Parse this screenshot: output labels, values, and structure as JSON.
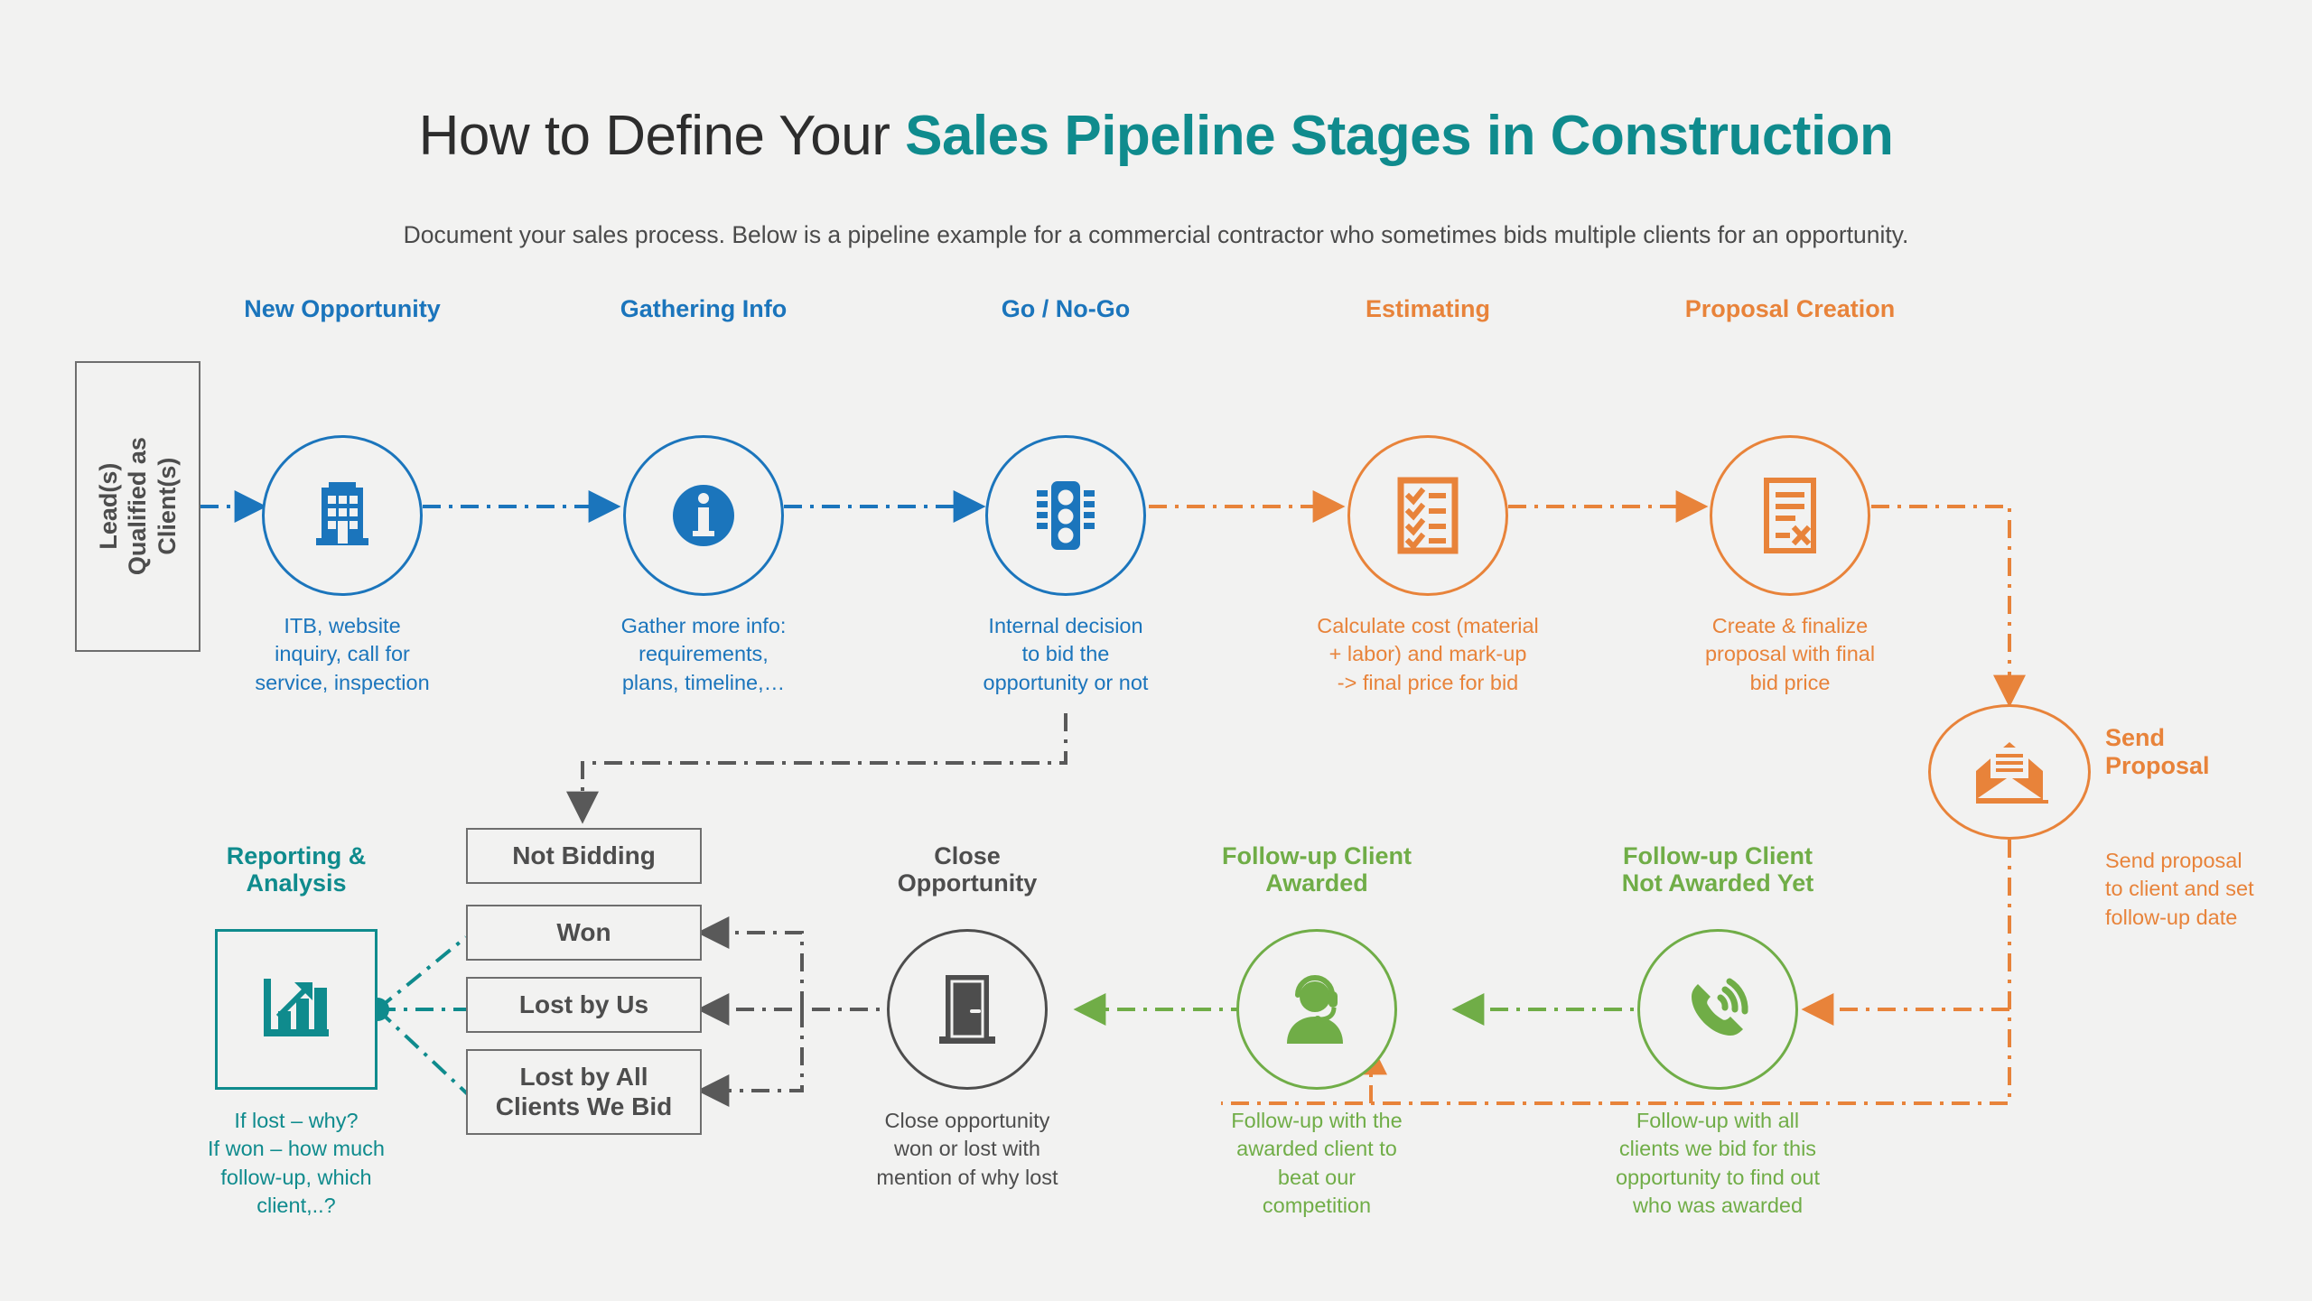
{
  "header": {
    "title_plain": "How to Define Your ",
    "title_accent": "Sales Pipeline Stages in Construction",
    "subtitle": "Document your sales process. Below is a pipeline example for a commercial contractor who sometimes bids multiple clients for an opportunity."
  },
  "colors": {
    "background": "#f2f2f1",
    "blue": "#1b75bc",
    "orange": "#e8833a",
    "green": "#70ad47",
    "teal": "#0f8b8d",
    "gray": "#4d4d4d",
    "gray_line": "#595959"
  },
  "lead_box": {
    "line1": "Lead(s)",
    "line2": "Qualified as",
    "line3": "Client(s)"
  },
  "stages": [
    {
      "id": "new-opportunity",
      "label": "New Opportunity",
      "icon": "office-building-icon",
      "color": "#1b75bc",
      "desc": [
        "ITB, website",
        "inquiry, call for",
        "service, inspection"
      ]
    },
    {
      "id": "gathering-info",
      "label": "Gathering Info",
      "icon": "info-circle-icon",
      "color": "#1b75bc",
      "desc": [
        "Gather more info:",
        "requirements,",
        "plans, timeline,…"
      ]
    },
    {
      "id": "go-no-go",
      "label": "Go / No-Go",
      "icon": "traffic-light-icon",
      "color": "#1b75bc",
      "desc": [
        "Internal decision",
        "to bid the",
        "opportunity or not"
      ]
    },
    {
      "id": "estimating",
      "label": "Estimating",
      "icon": "checklist-clipboard-icon",
      "color": "#e8833a",
      "desc": [
        "Calculate cost (material",
        "+ labor) and mark-up",
        "-> final price for bid"
      ]
    },
    {
      "id": "proposal-creation",
      "label": "Proposal Creation",
      "icon": "document-signed-icon",
      "color": "#e8833a",
      "desc": [
        "Create & finalize",
        "proposal with final",
        "bid price"
      ]
    },
    {
      "id": "send-proposal",
      "label_l1": "Send",
      "label_l2": "Proposal",
      "icon": "open-envelope-icon",
      "color": "#e8833a",
      "desc": [
        "Send proposal",
        "to client and set",
        "follow-up date"
      ]
    },
    {
      "id": "follow-up-not-awarded",
      "label_l1": "Follow-up Client",
      "label_l2": "Not Awarded Yet",
      "icon": "phone-ringing-icon",
      "color": "#70ad47",
      "desc": [
        "Follow-up with all",
        "clients we bid for this",
        "opportunity to find out",
        "who was awarded"
      ]
    },
    {
      "id": "follow-up-awarded",
      "label_l1": "Follow-up Client",
      "label_l2": "Awarded",
      "icon": "headset-agent-icon",
      "color": "#70ad47",
      "desc": [
        "Follow-up with the",
        "awarded client to",
        "beat our",
        "competition"
      ]
    },
    {
      "id": "close-opportunity",
      "label_l1": "Close",
      "label_l2": "Opportunity",
      "icon": "door-icon",
      "color": "#4d4d4d",
      "desc": [
        "Close opportunity",
        "won or lost with",
        "mention of why lost"
      ]
    },
    {
      "id": "reporting-analysis",
      "label_l1": "Reporting &",
      "label_l2": "Analysis",
      "icon": "bar-chart-growth-icon",
      "color": "#0f8b8d",
      "desc": [
        "If lost – why?",
        "If won – how much",
        "follow-up, which",
        "client,..?"
      ]
    }
  ],
  "result_boxes": [
    {
      "id": "not-bidding",
      "label": "Not Bidding"
    },
    {
      "id": "won",
      "label": "Won"
    },
    {
      "id": "lost-by-us",
      "label": "Lost by Us"
    },
    {
      "id": "lost-by-all",
      "line1": "Lost by All",
      "line2": "Clients We Bid"
    }
  ]
}
